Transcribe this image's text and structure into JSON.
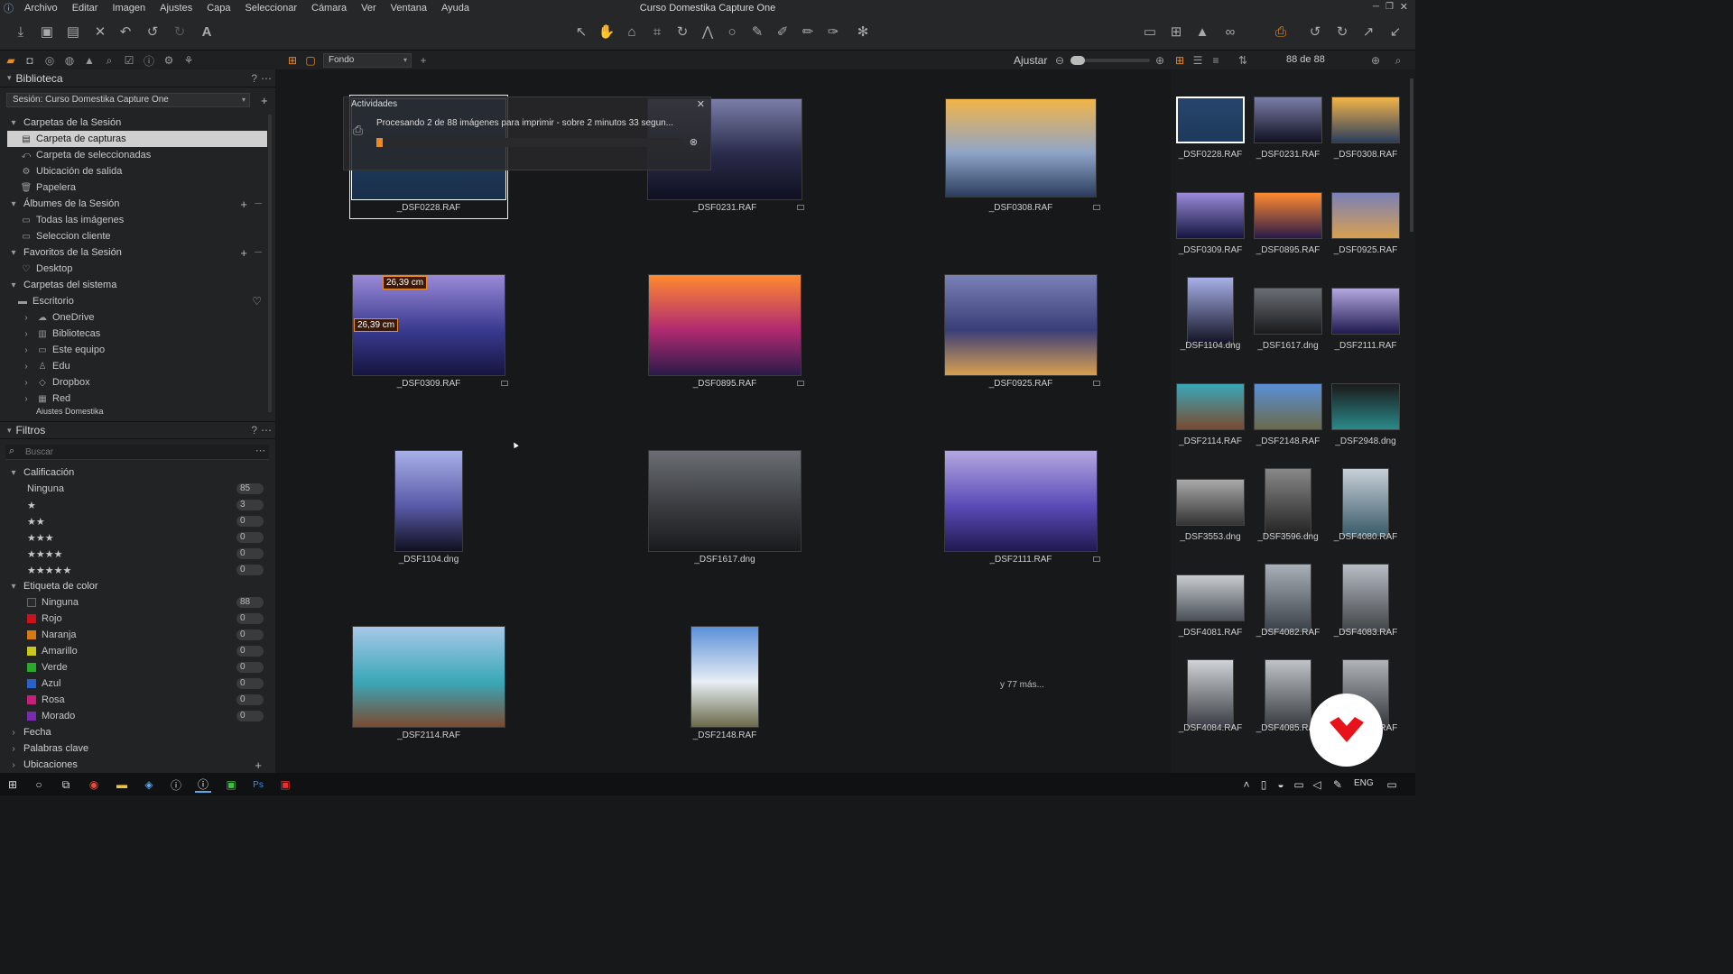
{
  "menubar": {
    "items": [
      "Archivo",
      "Editar",
      "Imagen",
      "Ajustes",
      "Capa",
      "Seleccionar",
      "Cámara",
      "Ver",
      "Ventana",
      "Ayuda"
    ],
    "title": "Curso Domestika Capture One"
  },
  "toolbar": {
    "left_icons": [
      "download-icon",
      "camera-icon",
      "folder-icon",
      "close-icon",
      "undo-icon",
      "undo-icon",
      "redo-icon",
      "text-icon"
    ],
    "center_icons": [
      "pointer-icon",
      "hand-icon",
      "stamp-icon",
      "crop-icon",
      "rotate-icon",
      "keystone-icon",
      "circle-icon",
      "brush-icon",
      "brush-icon",
      "eraser-icon",
      "gradient-icon",
      "picker-icon"
    ],
    "right_icons": [
      "compare-icon",
      "grid-icon",
      "warning-icon",
      "glasses-icon",
      "print-icon",
      "rotate-left-icon",
      "rotate-right-icon",
      "expand-icon",
      "collapse-icon"
    ]
  },
  "tabbar": {
    "viewmode": "Fondo",
    "zoom_label": "Ajustar",
    "count": "88 de 88"
  },
  "library": {
    "title": "Biblioteca",
    "session_select": "Sesión: Curso Domestika Capture One",
    "session_folders_title": "Carpetas de la Sesión",
    "session_folders": [
      "Carpeta de capturas",
      "Carpeta de seleccionadas",
      "Ubicación de salida",
      "Papelera"
    ],
    "albums_title": "Álbumes de la Sesión",
    "albums": [
      "Todas las imágenes",
      "Seleccion cliente"
    ],
    "favorites_title": "Favoritos de la Sesión",
    "favorites": [
      "Desktop"
    ],
    "system_title": "Carpetas del sistema",
    "system": [
      "Escritorio",
      "OneDrive",
      "Bibliotecas",
      "Este equipo",
      "Edu",
      "Dropbox",
      "Red",
      "Ajustes Domestika"
    ]
  },
  "filters": {
    "title": "Filtros",
    "search_placeholder": "Buscar",
    "rating_title": "Calificación",
    "ratings": [
      {
        "label": "Ninguna",
        "count": "85"
      },
      {
        "label": "★",
        "count": "3"
      },
      {
        "label": "★★",
        "count": "0"
      },
      {
        "label": "★★★",
        "count": "0"
      },
      {
        "label": "★★★★",
        "count": "0"
      },
      {
        "label": "★★★★★",
        "count": "0"
      }
    ],
    "color_title": "Etiqueta de color",
    "colors": [
      {
        "label": "Ninguna",
        "count": "88",
        "color": "#2a2a2a"
      },
      {
        "label": "Rojo",
        "count": "0",
        "color": "#c8121c"
      },
      {
        "label": "Naranja",
        "count": "0",
        "color": "#d97a10"
      },
      {
        "label": "Amarillo",
        "count": "0",
        "color": "#c8c81c"
      },
      {
        "label": "Verde",
        "count": "0",
        "color": "#2aa82a"
      },
      {
        "label": "Azul",
        "count": "0",
        "color": "#2a62c8"
      },
      {
        "label": "Rosa",
        "count": "0",
        "color": "#c8207a"
      },
      {
        "label": "Morado",
        "count": "0",
        "color": "#7a2ab0"
      }
    ],
    "more": [
      "Fecha",
      "Palabras clave",
      "Ubicaciones"
    ]
  },
  "activities": {
    "title": "Actividades",
    "message": "Procesando 2 de 88 imágenes para imprimir - sobre 2 minutos 33 segun...",
    "progress": 0.02
  },
  "viewer": {
    "measure_label": "26,39 cm",
    "more_label": "y 77 más...",
    "images": [
      {
        "name": "_DSF0228.RAF",
        "palette": [
          "#27456b",
          "#1d3a5c",
          "#1a2f4a"
        ]
      },
      {
        "name": "_DSF0231.RAF",
        "palette": [
          "#7a7ea8",
          "#2a2a4a",
          "#101020"
        ]
      },
      {
        "name": "_DSF0308.RAF",
        "palette": [
          "#f2b448",
          "#8fa5c8",
          "#2a3d5e"
        ]
      },
      {
        "name": "_DSF0309.RAF",
        "palette": [
          "#9a8ad8",
          "#3a3a90",
          "#151540"
        ]
      },
      {
        "name": "_DSF0895.RAF",
        "palette": [
          "#ff8a30",
          "#b02a70",
          "#2a1a4a"
        ]
      },
      {
        "name": "_DSF0925.RAF",
        "palette": [
          "#7a80b8",
          "#3a3e78",
          "#d8a050"
        ]
      },
      {
        "name": "_DSF1104.dng",
        "palette": [
          "#a8b0e8",
          "#5a5aa8",
          "#101020"
        ]
      },
      {
        "name": "_DSF1617.dng",
        "palette": [
          "#6a6e74",
          "#3a3c40",
          "#1a1a1c"
        ]
      },
      {
        "name": "_DSF2111.RAF",
        "palette": [
          "#b4a8e0",
          "#5a4ab8",
          "#201a50"
        ]
      },
      {
        "name": "_DSF2114.RAF",
        "palette": [
          "#a8c8e8",
          "#3aa8b8",
          "#7a4a30"
        ]
      },
      {
        "name": "_DSF2148.RAF",
        "palette": [
          "#5a90d8",
          "#e8eef4",
          "#6a6a4a"
        ]
      }
    ]
  },
  "browser": {
    "items": [
      {
        "name": "_DSF0228.RAF",
        "palette": [
          "#27456b",
          "#1d3a5c"
        ]
      },
      {
        "name": "_DSF0231.RAF",
        "palette": [
          "#7a7ea8",
          "#101020"
        ]
      },
      {
        "name": "_DSF0308.RAF",
        "palette": [
          "#f2b448",
          "#2a3d5e"
        ]
      },
      {
        "name": "_DSF0309.RAF",
        "palette": [
          "#9a8ad8",
          "#151540"
        ]
      },
      {
        "name": "_DSF0895.RAF",
        "palette": [
          "#ff8a30",
          "#2a1a4a"
        ]
      },
      {
        "name": "_DSF0925.RAF",
        "palette": [
          "#7a80b8",
          "#d8a050"
        ]
      },
      {
        "name": "_DSF1104.dng",
        "palette": [
          "#a8b0e8",
          "#101020"
        ]
      },
      {
        "name": "_DSF1617.dng",
        "palette": [
          "#6a6e74",
          "#1a1a1c"
        ]
      },
      {
        "name": "_DSF2111.RAF",
        "palette": [
          "#b4a8e0",
          "#201a50"
        ]
      },
      {
        "name": "_DSF2114.RAF",
        "palette": [
          "#3aa8b8",
          "#7a4a30"
        ]
      },
      {
        "name": "_DSF2148.RAF",
        "palette": [
          "#5a90d8",
          "#6a6a4a"
        ]
      },
      {
        "name": "_DSF2948.dng",
        "palette": [
          "#1a1a1a",
          "#2a8a8a"
        ]
      },
      {
        "name": "_DSF3553.dng",
        "palette": [
          "#aaaaaa",
          "#333333"
        ]
      },
      {
        "name": "_DSF3596.dng",
        "palette": [
          "#888888",
          "#222222"
        ]
      },
      {
        "name": "_DSF4080.RAF",
        "palette": [
          "#c8d0d8",
          "#3a5a6a"
        ]
      },
      {
        "name": "_DSF4081.RAF",
        "palette": [
          "#c8ccd0",
          "#4a5058"
        ]
      },
      {
        "name": "_DSF4082.RAF",
        "palette": [
          "#aab0b8",
          "#3a4048"
        ]
      },
      {
        "name": "_DSF4083.RAF",
        "palette": [
          "#b8bcc4",
          "#404448"
        ]
      },
      {
        "name": "_DSF4084.RAF",
        "palette": [
          "#d0d4d8",
          "#3a3e44"
        ]
      },
      {
        "name": "_DSF4085.RAF",
        "palette": [
          "#c0c4c8",
          "#383c40"
        ]
      },
      {
        "name": "_DSF4086.RAF",
        "palette": [
          "#b0b4b8",
          "#34383c"
        ]
      }
    ]
  },
  "taskbar": {
    "lang": "ENG"
  }
}
